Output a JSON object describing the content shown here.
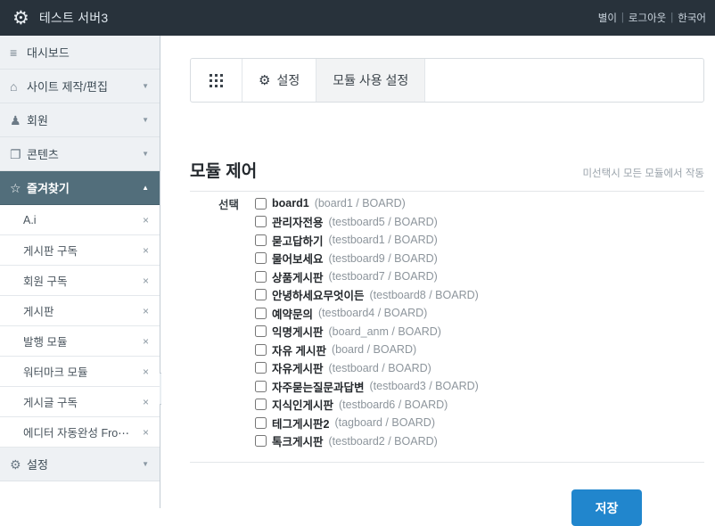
{
  "topbar": {
    "logo_icon": "gear-icon",
    "title": "테스트 서버3",
    "user": "별이",
    "sep1": "|",
    "logout": "로그아웃",
    "sep2": "|",
    "language": "한국어"
  },
  "sidebar": {
    "nav": [
      {
        "icon": "hamburger-icon",
        "glyph": "≡",
        "label": "대시보드",
        "caret": "",
        "active": false
      },
      {
        "icon": "home-icon",
        "glyph": "⌂",
        "label": "사이트 제작/편집",
        "caret": "▼",
        "active": false
      },
      {
        "icon": "users-icon",
        "glyph": "♟",
        "label": "회원",
        "caret": "▼",
        "active": false
      },
      {
        "icon": "document-icon",
        "glyph": "❐",
        "label": "콘텐츠",
        "caret": "▼",
        "active": false
      },
      {
        "icon": "star-icon",
        "glyph": "☆",
        "label": "즐겨찾기",
        "caret": "▲",
        "active": true
      }
    ],
    "favorites": [
      {
        "label": "A.i",
        "close": "×"
      },
      {
        "label": "게시판 구독",
        "close": "×"
      },
      {
        "label": "회원 구독",
        "close": "×"
      },
      {
        "label": "게시판",
        "close": "×"
      },
      {
        "label": "발행 모듈",
        "close": "×"
      },
      {
        "label": "워터마크 모듈",
        "close": "×"
      },
      {
        "label": "게시글 구독",
        "close": "×"
      },
      {
        "label": "에디터 자동완성 Fro⋯",
        "close": "×"
      }
    ],
    "settings": {
      "icon": "gear-icon",
      "glyph": "⚙",
      "label": "설정",
      "caret": "▼"
    },
    "collapse_handle": "◀"
  },
  "tabs": {
    "handle_icon": "dots-grid-icon",
    "items": [
      {
        "icon": "gear-icon",
        "glyph": "⚙",
        "label": "설정",
        "active": true
      },
      {
        "icon": "",
        "glyph": "",
        "label": "모듈 사용 설정",
        "active": false
      }
    ]
  },
  "section": {
    "title": "모듈 제어",
    "note": "미선택시 모든 모듈에서 작동",
    "field_label": "선택"
  },
  "modules": [
    {
      "name": "board1",
      "meta": "(board1 / BOARD)",
      "checked": false
    },
    {
      "name": "관리자전용",
      "meta": "(testboard5 / BOARD)",
      "checked": false
    },
    {
      "name": "묻고답하기",
      "meta": "(testboard1 / BOARD)",
      "checked": false
    },
    {
      "name": "물어보세요",
      "meta": "(testboard9 / BOARD)",
      "checked": false
    },
    {
      "name": "상품게시판",
      "meta": "(testboard7 / BOARD)",
      "checked": false
    },
    {
      "name": "안녕하세요무엇이든",
      "meta": "(testboard8 / BOARD)",
      "checked": false
    },
    {
      "name": "예약문의",
      "meta": "(testboard4 / BOARD)",
      "checked": false
    },
    {
      "name": "익명게시판",
      "meta": "(board_anm / BOARD)",
      "checked": false
    },
    {
      "name": "자유 게시판",
      "meta": "(board / BOARD)",
      "checked": false
    },
    {
      "name": "자유게시판",
      "meta": "(testboard / BOARD)",
      "checked": false
    },
    {
      "name": "자주묻는질문과답변",
      "meta": "(testboard3 / BOARD)",
      "checked": false
    },
    {
      "name": "지식인게시판",
      "meta": "(testboard6 / BOARD)",
      "checked": false
    },
    {
      "name": "테그게시판2",
      "meta": "(tagboard / BOARD)",
      "checked": false
    },
    {
      "name": "톡크게시판",
      "meta": "(testboard2 / BOARD)",
      "checked": false
    }
  ],
  "footer": {
    "save_label": "저장"
  },
  "colors": {
    "topbar_bg": "#28323b",
    "sidebar_active_bg": "#526e7b",
    "accent_button": "#2186cd",
    "nav_bg": "#eef1f4"
  }
}
